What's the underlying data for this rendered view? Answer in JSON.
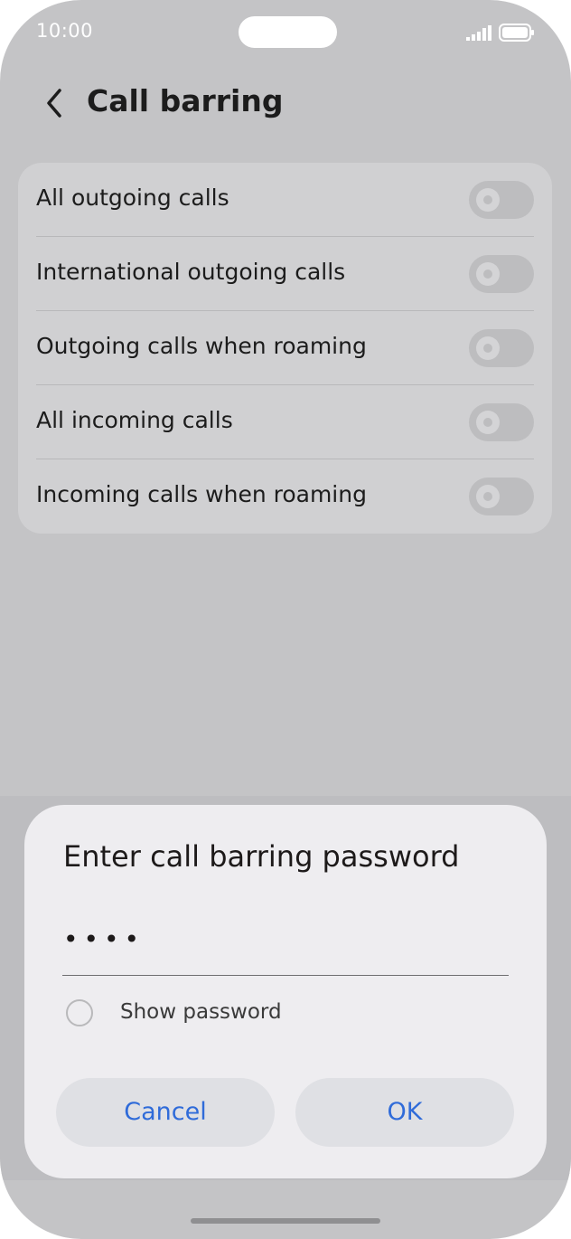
{
  "status_bar": {
    "time": "10:00",
    "signal_icon": "signal-bars-icon",
    "battery_icon": "battery-icon"
  },
  "header": {
    "back_icon": "chevron-left-icon",
    "title": "Call barring"
  },
  "settings": {
    "items": [
      {
        "label": "All outgoing calls",
        "enabled": false
      },
      {
        "label": "International outgoing calls",
        "enabled": false
      },
      {
        "label": "Outgoing calls when roaming",
        "enabled": false
      },
      {
        "label": "All incoming calls",
        "enabled": false
      },
      {
        "label": "Incoming calls when roaming",
        "enabled": false
      }
    ]
  },
  "dialog": {
    "title": "Enter call barring password",
    "password_value": "••••",
    "show_password_label": "Show password",
    "show_password_checked": false,
    "cancel_label": "Cancel",
    "ok_label": "OK"
  },
  "colors": {
    "accent": "#2f6bd9",
    "background": "#c4c4c6",
    "dialog_background": "#eeedf0"
  }
}
